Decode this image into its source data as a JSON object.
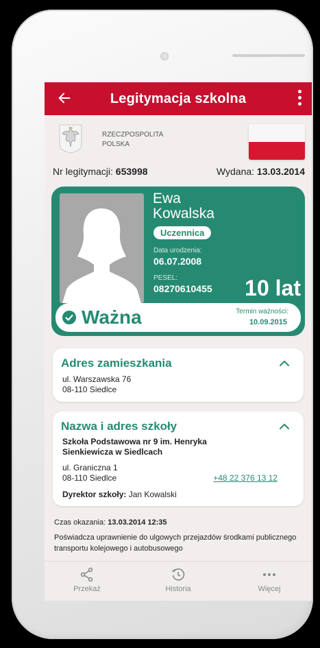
{
  "appbar": {
    "title": "Legitymacja szkolna",
    "back_icon": "arrow-left-icon",
    "more_icon": "more-vert-icon",
    "color": "#c8102e"
  },
  "header": {
    "country_line1": "RZECZPOSPOLITA",
    "country_line2": "POLSKA",
    "emblem_icon": "polish-eagle-icon",
    "flag_icon": "polish-flag-icon"
  },
  "id_info": {
    "number_label": "Nr legitymacji:",
    "number": "653998",
    "issued_label": "Wydana:",
    "issued": "13.03.2014"
  },
  "card": {
    "first_name": "Ewa",
    "last_name": "Kowalska",
    "role": "Uczennica",
    "birth_label": "Data urodzenia:",
    "birth_date": "06.07.2008",
    "pesel_label": "PESEL:",
    "pesel": "08270610455",
    "age": "10 lat",
    "status": "Ważna",
    "expiry_label": "Termin ważności:",
    "expiry": "10.09.2015",
    "color": "#268a72"
  },
  "address": {
    "title": "Adres zamieszkania",
    "line1": "ul. Warszawska 76",
    "line2": "08-110 Siedlce"
  },
  "school": {
    "title": "Nazwa i adres szkoły",
    "name_line1": "Szkoła Podstawowa nr 9 im. Henryka",
    "name_line2": "Sienkiewicza w Siedlcach",
    "addr_line1": "ul. Graniczna 1",
    "addr_line2": "08-110 Siedlce",
    "phone": "+48 22 376 13 12",
    "director_label": "Dyrektor szkoły:",
    "director": "Jan Kowalski"
  },
  "footer": {
    "shown_label": "Czas okazania:",
    "shown_time": "13.03.2014 12:35",
    "description": "Poświadcza uprawnienie do ulgowych przejazdów środkami publicznego transportu kolejowego i autobusowego"
  },
  "nav": [
    {
      "label": "Przekaż",
      "icon": "share-icon"
    },
    {
      "label": "Historia",
      "icon": "history-icon"
    },
    {
      "label": "Więcej",
      "icon": "more-horiz-icon"
    }
  ]
}
